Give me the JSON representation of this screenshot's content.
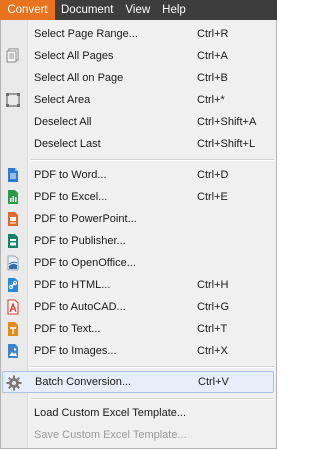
{
  "menubar": {
    "items": [
      {
        "label": "Convert",
        "active": true
      },
      {
        "label": "Document",
        "active": false
      },
      {
        "label": "View",
        "active": false
      },
      {
        "label": "Help",
        "active": false
      }
    ]
  },
  "menu": {
    "items": [
      {
        "label": "Select Page Range...",
        "shortcut": "Ctrl+R",
        "icon": "none"
      },
      {
        "label": "Select All Pages",
        "shortcut": "Ctrl+A",
        "icon": "pages-icon"
      },
      {
        "label": "Select All on Page",
        "shortcut": "Ctrl+B",
        "icon": "none"
      },
      {
        "label": "Select Area",
        "shortcut": "Ctrl+*",
        "icon": "select-area-icon"
      },
      {
        "label": "Deselect All",
        "shortcut": "Ctrl+Shift+A",
        "icon": "none"
      },
      {
        "label": "Deselect Last",
        "shortcut": "Ctrl+Shift+L",
        "icon": "none"
      },
      {
        "label": "PDF to Word...",
        "shortcut": "Ctrl+D",
        "icon": "word-icon",
        "color": "#2b7cd3"
      },
      {
        "label": "PDF to Excel...",
        "shortcut": "Ctrl+E",
        "icon": "excel-icon",
        "color": "#2e9a48"
      },
      {
        "label": "PDF to PowerPoint...",
        "shortcut": "",
        "icon": "powerpoint-icon",
        "color": "#e06a2c"
      },
      {
        "label": "PDF to Publisher...",
        "shortcut": "",
        "icon": "publisher-icon",
        "color": "#13836a"
      },
      {
        "label": "PDF to OpenOffice...",
        "shortcut": "",
        "icon": "openoffice-icon",
        "color": "#2f6fae"
      },
      {
        "label": "PDF to HTML...",
        "shortcut": "Ctrl+H",
        "icon": "html-icon",
        "color": "#2a8ad6"
      },
      {
        "label": "PDF to AutoCAD...",
        "shortcut": "Ctrl+G",
        "icon": "autocad-icon",
        "color": "#d9362b"
      },
      {
        "label": "PDF to Text...",
        "shortcut": "Ctrl+T",
        "icon": "text-icon",
        "color": "#e58a1c"
      },
      {
        "label": "PDF to Images...",
        "shortcut": "Ctrl+X",
        "icon": "images-icon",
        "color": "#3a86d1"
      },
      {
        "label": "Batch Conversion...",
        "shortcut": "Ctrl+V",
        "icon": "gear-icon"
      },
      {
        "label": "Load Custom Excel Template...",
        "shortcut": "",
        "icon": "none"
      },
      {
        "label": "Save Custom Excel Template...",
        "shortcut": "",
        "icon": "none",
        "disabled": true
      }
    ]
  }
}
